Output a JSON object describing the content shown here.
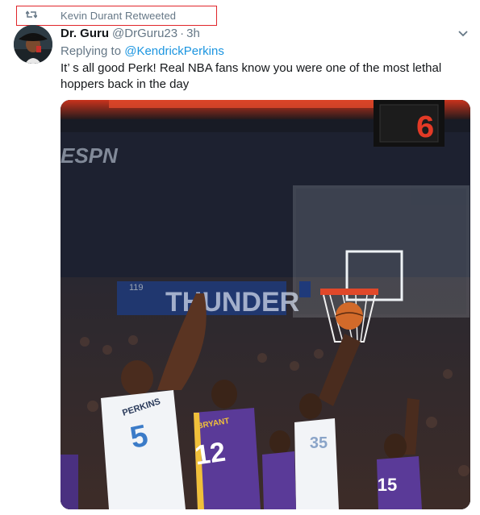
{
  "retweet": {
    "icon": "retweet-icon",
    "label": "Kevin Durant Retweeted",
    "highlight_color": "#e0262b"
  },
  "tweet": {
    "display_name": "Dr. Guru",
    "handle": "@DrGuru23",
    "separator": "·",
    "time": "3h",
    "replying_prefix": "Replying to",
    "replying_to": "@KendrickPerkins",
    "text": "It’ s all good Perk! Real NBA fans know you were one of the most lethal hoppers back in the day",
    "caret_icon": "chevron-down-icon",
    "link_color": "#1b95e0"
  },
  "media": {
    "scoreboard_digit": "6",
    "broadcaster": "ESPN",
    "banner_text": "THUNDER",
    "section_number": "119",
    "jersey_left_name": "PERKINS",
    "jersey_left_number": "5",
    "jersey_mid_name": "BRYANT",
    "jersey_mid_number": "12",
    "jersey_center_number": "35",
    "jersey_right_number": "15"
  }
}
